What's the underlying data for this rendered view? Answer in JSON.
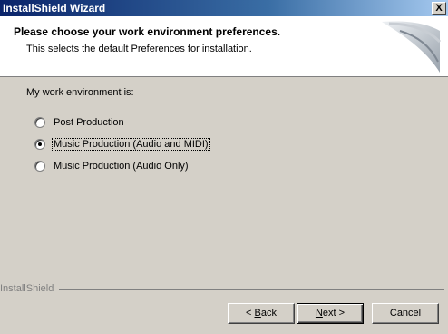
{
  "window": {
    "title": "InstallShield Wizard",
    "close_glyph": "X"
  },
  "header": {
    "title": "Please choose your work environment preferences.",
    "subtitle": "This selects the default Preferences for installation."
  },
  "body": {
    "prompt": "My work environment is:",
    "options": [
      {
        "label": "Post Production",
        "checked": false
      },
      {
        "label": "Music Production (Audio and MIDI)",
        "checked": true
      },
      {
        "label": "Music Production (Audio Only)",
        "checked": false
      }
    ]
  },
  "footer": {
    "brand": "InstallShield",
    "back_label_pre": "< ",
    "back_mnemonic": "B",
    "back_label_post": "ack",
    "next_mnemonic": "N",
    "next_label_post": "ext >",
    "cancel_label": "Cancel"
  }
}
